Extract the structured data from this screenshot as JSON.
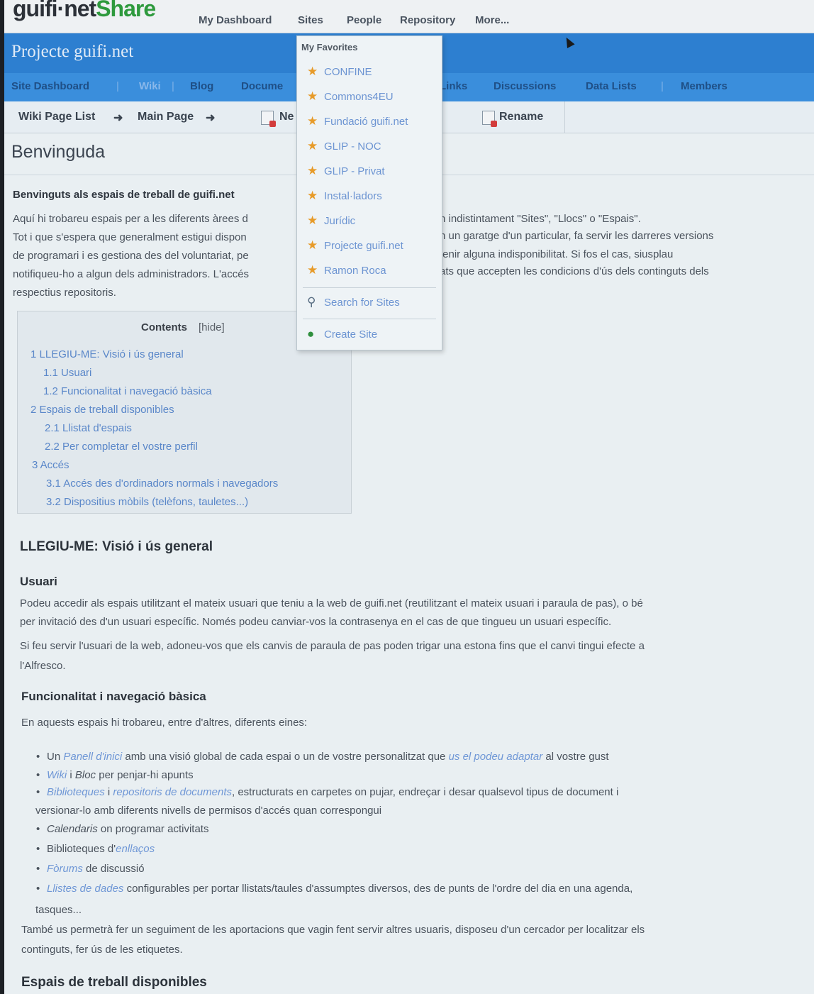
{
  "header": {
    "logo_part1": "guifi·net",
    "logo_part2": "Share",
    "nav": [
      "My Dashboard",
      "Sites",
      "People",
      "Repository",
      "More..."
    ]
  },
  "site": {
    "title": "Projecte guifi.net",
    "tabs": [
      "Site Dashboard",
      "Wiki",
      "Blog",
      "Docume",
      "Links",
      "Discussions",
      "Data Lists",
      "Members"
    ]
  },
  "wikibar": {
    "page_list": "Wiki Page List",
    "main_page": "Main Page",
    "new": "Ne",
    "rename": "Rename"
  },
  "page": {
    "title": "Benvinguda",
    "intro_heading": "Benvinguts als espais de treball de guifi.net",
    "intro_lines": [
      "Aquí hi trobareu espais per a les diferents àrees d",
      "Tot i que s'espera que generalment estigui dispon",
      "de programari i es gestiona des del voluntariat, pe",
      "notifiqueu-ho a algun dels administradors. L'accés",
      "respectius repositoris."
    ],
    "intro_right": [
      "n indistintament \"Sites\", \"Llocs\" o \"Espais\".",
      "n un garatge d'un particular, fa servir les darreres versions",
      "tenir alguna indisponibilitat. Si fos el cas, siusplau",
      "ats que accepten les condicions d'ús dels continguts dels"
    ],
    "toc": {
      "title": "Contents",
      "hide": "[hide]",
      "items": [
        "1 LLEGIU-ME: Visió i ús general",
        "1.1 Usuari",
        "1.2 Funcionalitat i navegació bàsica",
        "2 Espais de treball disponibles",
        "2.1 Llistat d'espais",
        "2.2 Per completar el vostre perfil",
        "3 Accés",
        "3.1 Accés des d'ordinadors normals i navegadors",
        "3.2 Dispositius mòbils (telèfons, tauletes...)"
      ]
    },
    "h_llegiu": "LLEGIU-ME: Visió i ús general",
    "h_usuari": "Usuari",
    "usuari_lines": [
      "Podeu accedir als espais utilitzant el mateix usuari que teniu a la web de guifi.net (reutilitzant el mateix usuari i paraula de pas), o bé",
      "per invitació des d'un usuari específic. Només podeu canviar-vos la contrasenya en el cas de que tingueu un usuari específic."
    ],
    "usuari_p2": [
      "Si feu servir l'usuari de la web, adoneu-vos que els canvis de paraula de pas poden trigar una estona fins que el canvi tingui efecte a",
      "l'Alfresco."
    ],
    "h_func": "Funcionalitat i navegació bàsica",
    "func_intro": "En aquests espais hi trobareu, entre d'altres, diferents eines:",
    "bullets": {
      "b1_a": "Un ",
      "b1_link": "Panell d'inici",
      "b1_b": " amb una visió global de cada espai o un de vostre personalitzat que ",
      "b1_link2": "us el podeu adaptar",
      "b1_c": " al vostre gust",
      "b2_link": "Wiki",
      "b2_a": " i ",
      "b2_it": "Bloc",
      "b2_b": " per penjar-hi apunts",
      "b3_link": "Biblioteques",
      "b3_a": " i ",
      "b3_link2": "repositoris de documents",
      "b3_b": ", estructurats en carpetes on pujar, endreçar i desar qualsevol tipus de document i",
      "b3_cont": "versionar-lo amb diferents nivells de permisos d'accés quan correspongui",
      "b4_it": "Calendaris",
      "b4_a": " on programar activitats",
      "b5_a": "Biblioteques d'",
      "b5_link": "enllaços",
      "b6_link": "Fòrums",
      "b6_a": " de discussió",
      "b7_link": "Llistes de dades",
      "b7_a": " configurables per portar llistats/taules d'assumptes diversos, des de punts de l'ordre del dia en una agenda,",
      "b7_cont": "tasques..."
    },
    "tambe_lines": [
      "També us permetrà fer un seguiment de les aportacions que vagin fent servir altres usuaris, disposeu d'un cercador per localitzar els",
      "continguts, fer ús de les etiquetes."
    ],
    "h_espais": "Espais de treball disponibles"
  },
  "dropdown": {
    "header": "My Favorites",
    "favorites": [
      "CONFINE",
      "Commons4EU",
      "Fundació guifi.net",
      "GLIP - NOC",
      "GLIP - Privat",
      "Instal·ladors",
      "Jurídic",
      "Projecte guifi.net",
      "Ramon Roca"
    ],
    "search": "Search for Sites",
    "create": "Create Site",
    "star_icon": "star-icon",
    "search_icon": "search-icon",
    "create_icon": "globe-icon"
  }
}
